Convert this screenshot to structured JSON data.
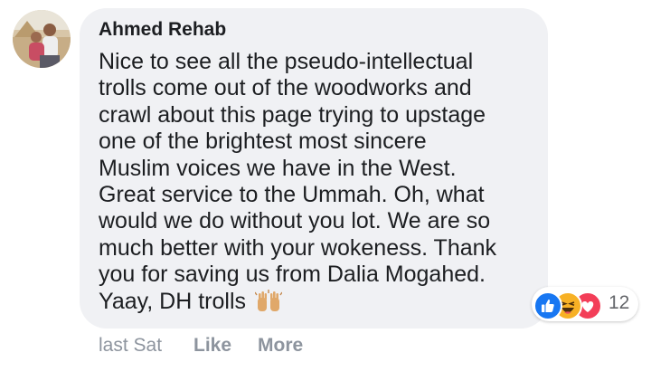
{
  "comment": {
    "author": "Ahmed Rehab",
    "text_lines": [
      "Nice to see all the pseudo-intellectual",
      "trolls come out of the woodworks and",
      "crawl about this page trying to upstage",
      "one of the brightest most sincere",
      "Muslim voices we have in the West.",
      "Great service to the Ummah. Oh, what",
      "would we do without you lot. We are so",
      "much better with your wokeness. Thank",
      "you for saving us from Dalia Mogahed.",
      "Yaay, DH trolls"
    ],
    "trailing_emoji": "raising-hands-emoji"
  },
  "reactions": {
    "types": [
      "like-icon",
      "haha-icon",
      "love-icon"
    ],
    "count": "12"
  },
  "actions": {
    "timestamp": "last Sat",
    "like_label": "Like",
    "more_label": "More"
  },
  "colors": {
    "bubble_bg": "#f0f1f4",
    "text": "#1c1e21",
    "muted": "#8d949e",
    "like_blue": "#1877f2",
    "haha_yellow": "#f7b125",
    "love_red": "#f33e58"
  }
}
